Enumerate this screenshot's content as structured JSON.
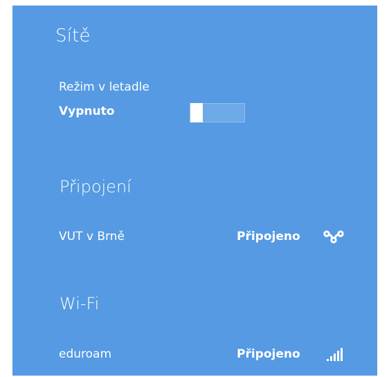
{
  "panel": {
    "title": "Sítě",
    "background": "#559ae2"
  },
  "airplane_mode": {
    "label": "Režim v letadle",
    "state": "Vypnuto",
    "enabled": false
  },
  "sections": {
    "connections": {
      "heading": "Připojení",
      "items": [
        {
          "name": "VUT v Brně",
          "status": "Připojeno",
          "icon": "ethernet-icon"
        }
      ]
    },
    "wifi": {
      "heading": "Wi-Fi",
      "items": [
        {
          "name": "eduroam",
          "status": "Připojeno",
          "icon": "wifi-signal-icon",
          "signal_bars": 5
        }
      ]
    }
  }
}
